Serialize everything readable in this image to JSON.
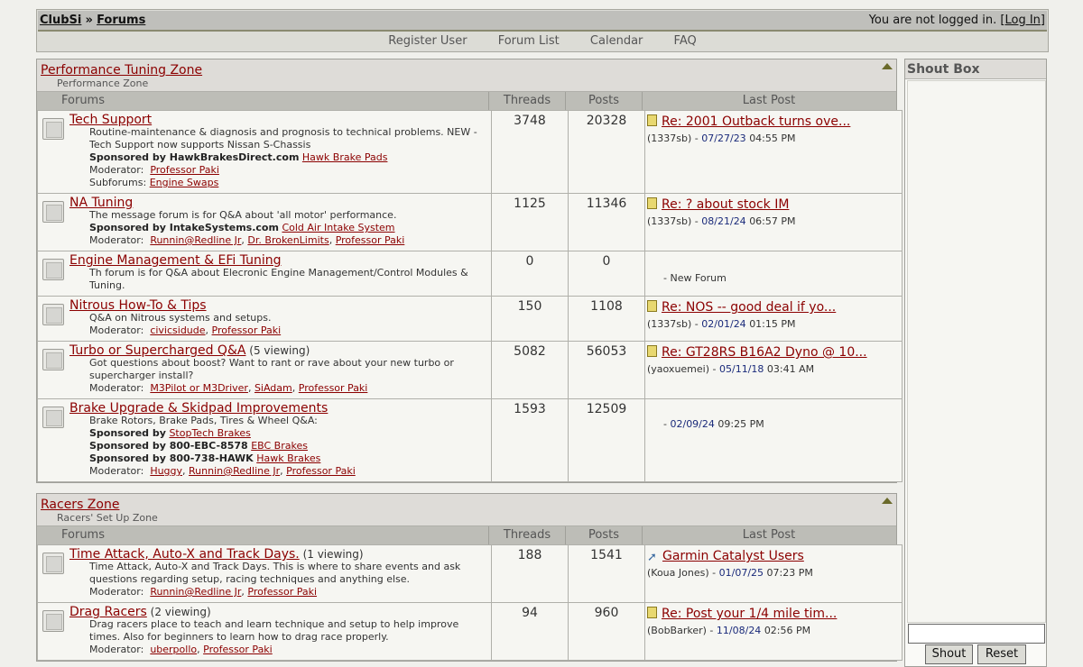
{
  "header": {
    "crumb_site": "ClubSi",
    "crumb_sep": "»",
    "crumb_forums": "Forums",
    "login_text": "You are not logged in.",
    "login_open": "[",
    "login_link": "Log In",
    "login_close": "]"
  },
  "nav": [
    "Register User",
    "Forum List",
    "Calendar",
    "FAQ"
  ],
  "columns": {
    "forums": "Forums",
    "threads": "Threads",
    "posts": "Posts",
    "last_post": "Last Post"
  },
  "categories": [
    {
      "title": "Performance Tuning Zone",
      "subtitle": "Performance Zone",
      "forums": [
        {
          "name": "Tech Support",
          "viewing": "",
          "desc": "Routine-maintenance & diagnosis and prognosis to technical problems. NEW - Tech Support now supports Nissan S-Chassis",
          "sponsor1_label": "Sponsored by HawkBrakesDirect.com",
          "sponsor1_link": "Hawk Brake Pads",
          "moderator_label": "Moderator:",
          "moderators": [
            "Professor Paki"
          ],
          "subforums_label": "Subforums:",
          "subforums": [
            "Engine Swaps"
          ],
          "threads": "3748",
          "posts": "20328",
          "last_title": "Re: 2001 Outback turns ove...",
          "last_user": "(1337sb)",
          "last_sep": "-",
          "last_date": "07/27/23",
          "last_time": "04:55 PM",
          "last_icon": "document-icon"
        },
        {
          "name": "NA Tuning",
          "viewing": "",
          "desc": "The message forum is for Q&A about 'all motor' performance.",
          "sponsor1_label": "Sponsored by IntakeSystems.com",
          "sponsor1_link": "Cold Air Intake System",
          "moderator_label": "Moderator:",
          "moderators": [
            "Runnin@Redline Jr",
            "Dr. BrokenLimits",
            "Professor Paki"
          ],
          "threads": "1125",
          "posts": "11346",
          "last_title": "Re: ? about stock IM",
          "last_user": "(1337sb)",
          "last_sep": "-",
          "last_date": "08/21/24",
          "last_time": "06:57 PM",
          "last_icon": "document-icon"
        },
        {
          "name": "Engine Management & EFi Tuning",
          "viewing": "",
          "desc": "Th forum is for Q&A about Elecronic Engine Management/Control Modules & Tuning.",
          "threads": "0",
          "posts": "0",
          "last_note": "- New Forum"
        },
        {
          "name": "Nitrous How-To & Tips",
          "viewing": "",
          "desc": "Q&A on Nitrous systems and setups.",
          "moderator_label": "Moderator:",
          "moderators": [
            "civicsidude",
            "Professor Paki"
          ],
          "threads": "150",
          "posts": "1108",
          "last_title": "Re: NOS -- good deal if yo...",
          "last_user": "(1337sb)",
          "last_sep": "-",
          "last_date": "02/01/24",
          "last_time": "01:15 PM",
          "last_icon": "document-icon"
        },
        {
          "name": "Turbo or Supercharged Q&A",
          "viewing": "(5 viewing)",
          "desc": "Got questions about boost? Want to rant or rave about your new turbo or supercharger install?",
          "moderator_label": "Moderator:",
          "moderators": [
            "M3Pilot or M3Driver",
            "SiAdam",
            "Professor Paki"
          ],
          "threads": "5082",
          "posts": "56053",
          "last_title": "Re: GT28RS B16A2 Dyno @ 10...",
          "last_user": "(yaoxuemei)",
          "last_sep": "-",
          "last_date": "05/11/18",
          "last_time": "03:41 AM",
          "last_icon": "document-icon"
        },
        {
          "name": "Brake Upgrade & Skidpad Improvements",
          "viewing": "",
          "desc": "Brake Rotors, Brake Pads, Tires & Wheel Q&A:",
          "sponsor1_label": "Sponsored by",
          "sponsor1_link": "StopTech Brakes",
          "sponsor2_label": "Sponsored by 800-EBC-8578",
          "sponsor2_link": "EBC Brakes",
          "sponsor3_label": "Sponsored by 800-738-HAWK",
          "sponsor3_link": "Hawk Brakes",
          "moderator_label": "Moderator:",
          "moderators": [
            "Huggy",
            "Runnin@Redline Jr",
            "Professor Paki"
          ],
          "threads": "1593",
          "posts": "12509",
          "last_sep": "-",
          "last_date": "02/09/24",
          "last_time": "09:25 PM"
        }
      ]
    },
    {
      "title": "Racers Zone",
      "subtitle": "Racers' Set Up Zone",
      "forums": [
        {
          "name": "Time Attack, Auto-X and Track Days.",
          "viewing": "(1 viewing)",
          "desc": "Time Attack, Auto-X and Track Days. This is where to share events and ask questions regarding setup, racing techniques and anything else.",
          "moderator_label": "Moderator:",
          "moderators": [
            "Runnin@Redline Jr",
            "Professor Paki"
          ],
          "threads": "188",
          "posts": "1541",
          "last_title": "Garmin Catalyst Users",
          "last_user": "(Koua Jones)",
          "last_sep": "-",
          "last_date": "01/07/25",
          "last_time": "07:23 PM",
          "last_icon": "rocket-icon"
        },
        {
          "name": "Drag Racers",
          "viewing": "(2 viewing)",
          "desc": "Drag racers place to teach and learn technique and setup to help improve times. Also for beginners to learn how to drag race properly.",
          "moderator_label": "Moderator:",
          "moderators": [
            "uberpollo",
            "Professor Paki"
          ],
          "threads": "94",
          "posts": "960",
          "last_title": "Re: Post your 1/4 mile tim...",
          "last_user": "(BobBarker)",
          "last_sep": "-",
          "last_date": "11/08/24",
          "last_time": "02:56 PM",
          "last_icon": "document-icon"
        }
      ]
    }
  ],
  "shoutbox": {
    "title": "Shout Box",
    "shout_label": "Shout",
    "reset_label": "Reset",
    "input_value": ""
  }
}
